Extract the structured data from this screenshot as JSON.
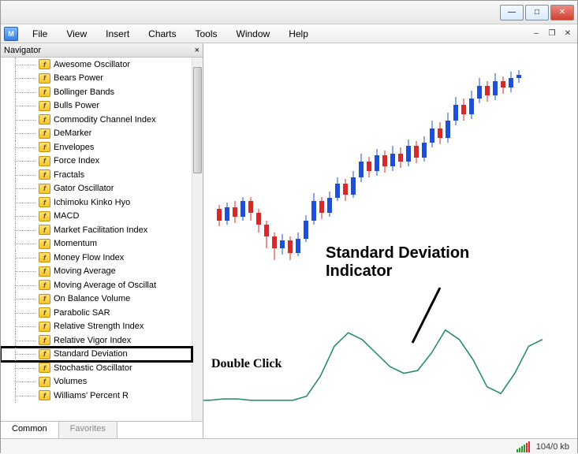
{
  "window": {
    "minimize_glyph": "—",
    "maximize_glyph": "□",
    "close_glyph": "✕"
  },
  "menubar": {
    "app_icon_text": "M",
    "items": [
      "File",
      "View",
      "Insert",
      "Charts",
      "Tools",
      "Window",
      "Help"
    ],
    "mdi": {
      "min": "–",
      "restore": "❐",
      "close": "✕"
    }
  },
  "navigator": {
    "title": "Navigator",
    "close_glyph": "×",
    "items": [
      "Awesome Oscillator",
      "Bears Power",
      "Bollinger Bands",
      "Bulls Power",
      "Commodity Channel Index",
      "DeMarker",
      "Envelopes",
      "Force Index",
      "Fractals",
      "Gator Oscillator",
      "Ichimoku Kinko Hyo",
      "MACD",
      "Market Facilitation Index",
      "Momentum",
      "Money Flow Index",
      "Moving Average",
      "Moving Average of Oscillat",
      "On Balance Volume",
      "Parabolic SAR",
      "Relative Strength Index",
      "Relative Vigor Index",
      "Standard Deviation",
      "Stochastic Oscillator",
      "Volumes",
      "Williams' Percent R"
    ],
    "highlighted_index": 21,
    "icon_glyph": "f",
    "tabs": {
      "common": "Common",
      "favorites": "Favorites"
    }
  },
  "annotations": {
    "main_title_line1": "Standard Deviation",
    "main_title_line2": "Indicator",
    "double_click": "Double Click"
  },
  "statusbar": {
    "traffic": "104/0 kb"
  },
  "chart_data": {
    "type": "candlestick+line",
    "candles_note": "Uptrending forex candlestick series with red bearish and blue bullish candles; price rises left-to-right with a dip near center.",
    "indicator_series": {
      "name": "Standard Deviation",
      "color": "#1f8a5a",
      "values": [
        0.1,
        0.1,
        0.11,
        0.11,
        0.1,
        0.1,
        0.1,
        0.1,
        0.13,
        0.28,
        0.5,
        0.6,
        0.55,
        0.45,
        0.35,
        0.3,
        0.32,
        0.45,
        0.62,
        0.55,
        0.4,
        0.2,
        0.15,
        0.3,
        0.5,
        0.55
      ]
    },
    "indicator_ylim": [
      0,
      0.7
    ]
  }
}
